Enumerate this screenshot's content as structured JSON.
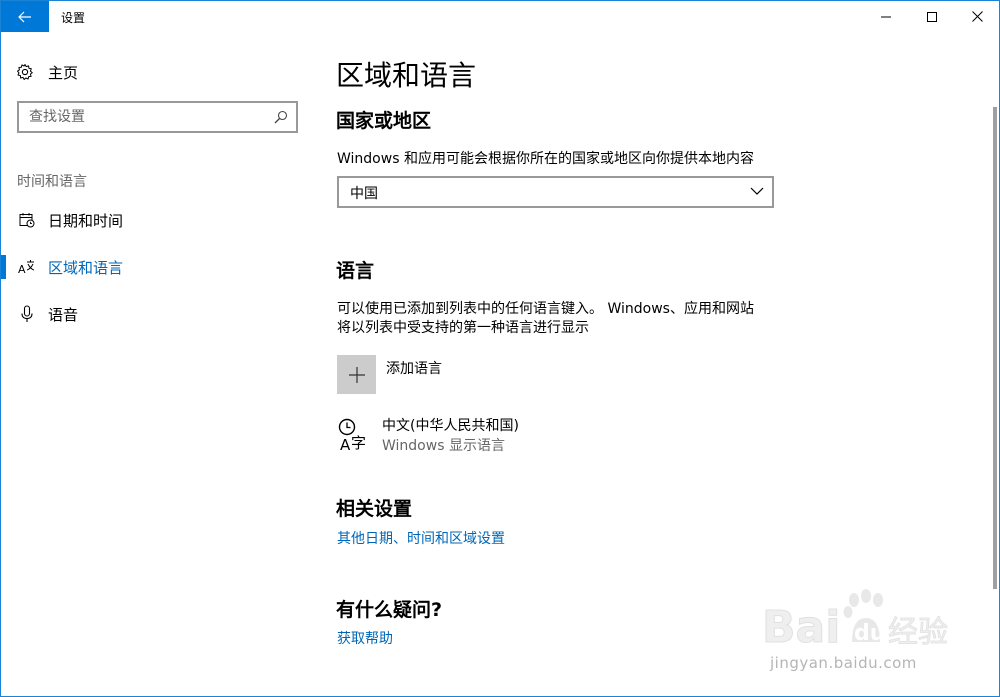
{
  "window": {
    "title": "设置"
  },
  "sidebar": {
    "home_label": "主页",
    "search_placeholder": "查找设置",
    "section_header": "时间和语言",
    "items": [
      {
        "label": "日期和时间",
        "icon": "calendar-clock-icon"
      },
      {
        "label": "区域和语言",
        "icon": "region-language-icon",
        "active": true
      },
      {
        "label": "语音",
        "icon": "microphone-icon"
      }
    ]
  },
  "main": {
    "page_title": "区域和语言",
    "country": {
      "heading": "国家或地区",
      "description": "Windows 和应用可能会根据你所在的国家或地区向你提供本地内容",
      "selected": "中国"
    },
    "language": {
      "heading": "语言",
      "description_line1": "可以使用已添加到列表中的任何语言键入。 Windows、应用和网站",
      "description_line2": "将以列表中受支持的第一种语言进行显示",
      "add_label": "添加语言",
      "item_name": "中文(中华人民共和国)",
      "item_subtitle": "Windows 显示语言"
    },
    "related": {
      "heading": "相关设置",
      "link": "其他日期、时间和区域设置"
    },
    "help": {
      "heading": "有什么疑问?",
      "link": "获取帮助"
    }
  },
  "watermark": {
    "text": "jingyan.baidu.com"
  },
  "colors": {
    "accent": "#0078d7",
    "link": "#0067b8",
    "secondary_text": "#666666"
  }
}
